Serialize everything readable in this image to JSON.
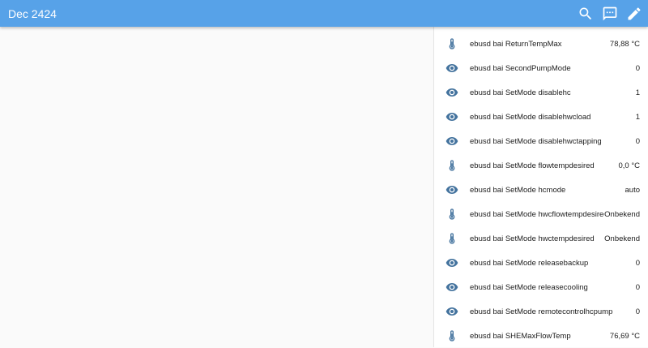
{
  "header": {
    "title": "Dec 2424"
  },
  "actions": [
    {
      "icon": "search-icon"
    },
    {
      "icon": "message-icon"
    },
    {
      "icon": "pencil-icon"
    }
  ],
  "entities": [
    {
      "name": "ebusd bai ReturnTempMax",
      "value": "78,88 °C",
      "icon": "thermometer-icon"
    },
    {
      "name": "ebusd bai SecondPumpMode",
      "value": "0",
      "icon": "eye-icon"
    },
    {
      "name": "ebusd bai SetMode disablehc",
      "value": "1",
      "icon": "eye-icon"
    },
    {
      "name": "ebusd bai SetMode disablehwcload",
      "value": "1",
      "icon": "eye-icon"
    },
    {
      "name": "ebusd bai SetMode disablehwctapping",
      "value": "0",
      "icon": "eye-icon"
    },
    {
      "name": "ebusd bai SetMode flowtempdesired",
      "value": "0,0 °C",
      "icon": "thermometer-icon"
    },
    {
      "name": "ebusd bai SetMode hcmode",
      "value": "auto",
      "icon": "eye-icon"
    },
    {
      "name": "ebusd bai SetMode hwcflowtempdesired",
      "value": "Onbekend",
      "icon": "thermometer-icon"
    },
    {
      "name": "ebusd bai SetMode hwctempdesired",
      "value": "Onbekend",
      "icon": "thermometer-icon"
    },
    {
      "name": "ebusd bai SetMode releasebackup",
      "value": "0",
      "icon": "eye-icon"
    },
    {
      "name": "ebusd bai SetMode releasecooling",
      "value": "0",
      "icon": "eye-icon"
    },
    {
      "name": "ebusd bai SetMode remotecontrolhcpump",
      "value": "0",
      "icon": "eye-icon"
    },
    {
      "name": "ebusd bai SHEMaxFlowTemp",
      "value": "76,69 °C",
      "icon": "thermometer-icon"
    }
  ]
}
